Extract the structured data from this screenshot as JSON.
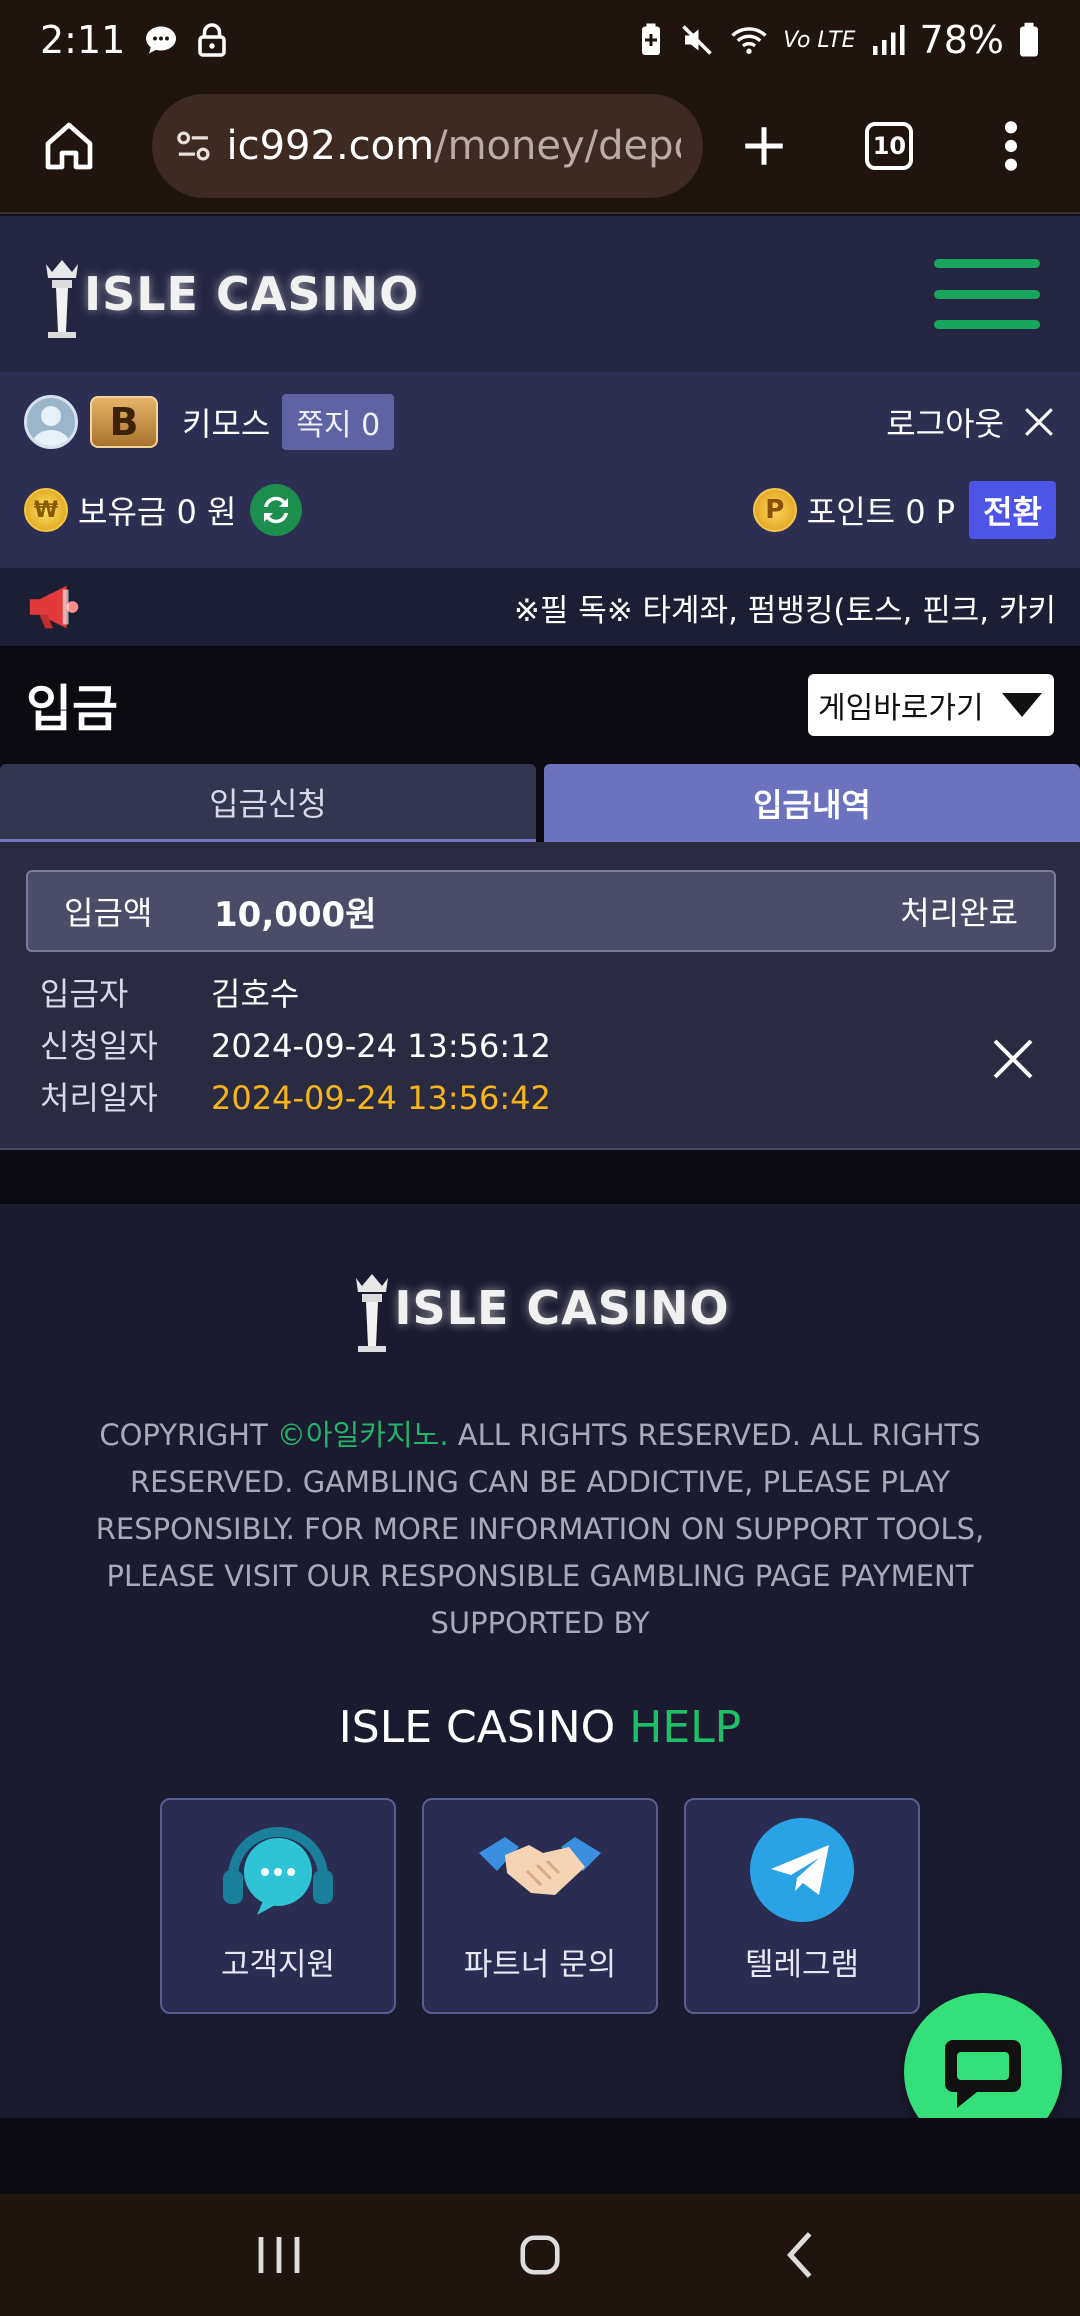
{
  "status_bar": {
    "time": "2:11",
    "battery": "78%",
    "network": "Vo LTE"
  },
  "browser": {
    "url_host": "ic992.com",
    "url_path": "/money/depos",
    "tab_count": "10"
  },
  "site": {
    "logo_text": "ISLE CASINO"
  },
  "user": {
    "level_badge": "B",
    "name": "키모스",
    "messages": "쪽지 0",
    "logout": "로그아웃",
    "balance": "보유금 0 원",
    "points": "포인트 0 P",
    "convert": "전환"
  },
  "notice": {
    "text": "※필 독※ 타계좌, 펌뱅킹(토스, 핀크, 카키"
  },
  "page": {
    "title": "입금",
    "game_shortcut": "게임바로가기"
  },
  "tabs": [
    {
      "label": "입금신청",
      "active": false
    },
    {
      "label": "입금내역",
      "active": true
    }
  ],
  "deposit_record": {
    "amount_label": "입금액",
    "amount": "10,000원",
    "status": "처리완료",
    "depositor_label": "입금자",
    "depositor": "김호수",
    "requested_label": "신청일자",
    "requested": "2024-09-24 13:56:12",
    "processed_label": "처리일자",
    "processed": "2024-09-24 13:56:42"
  },
  "footer": {
    "logo_text": "ISLE CASINO",
    "copyright_prefix": "COPYRIGHT ",
    "copyright_brand": "©아일카지노.",
    "copyright_body": " ALL RIGHTS RESERVED. ALL RIGHTS RESERVED. GAMBLING CAN BE ADDICTIVE, PLEASE PLAY RESPONSIBLY. FOR MORE INFORMATION ON SUPPORT TOOLS, PLEASE VISIT OUR RESPONSIBLE GAMBLING PAGE PAYMENT SUPPORTED BY",
    "help_title_a": "ISLE CASINO ",
    "help_title_b": "HELP",
    "help_buttons": [
      {
        "label": "고객지원",
        "icon": "headset-chat-icon"
      },
      {
        "label": "파트너 문의",
        "icon": "handshake-icon"
      },
      {
        "label": "텔레그램",
        "icon": "telegram-icon"
      }
    ]
  },
  "colors": {
    "accent_green": "#18a55e",
    "tab_active": "#6d72bf",
    "highlight_date": "#f4b41a",
    "chat_fab": "#35e07a"
  }
}
